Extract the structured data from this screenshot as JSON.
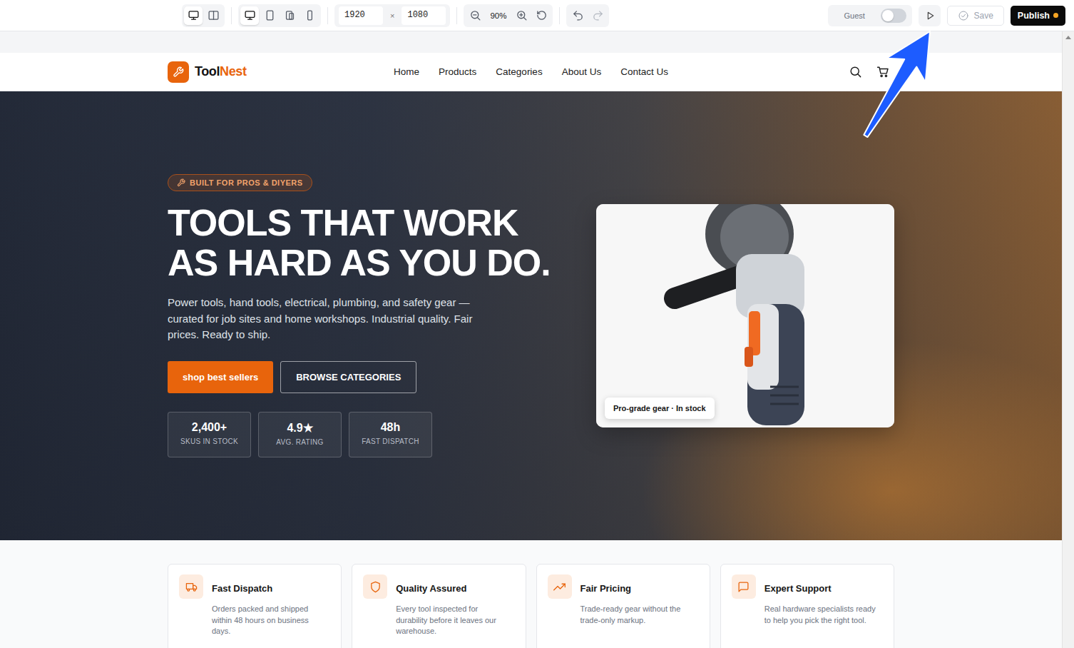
{
  "toolbar": {
    "view_modes": [
      {
        "kind": "single",
        "selected": true
      },
      {
        "kind": "split",
        "selected": false
      }
    ],
    "devices": [
      {
        "kind": "desktop",
        "selected": true
      },
      {
        "kind": "tablet",
        "selected": false
      },
      {
        "kind": "tablet-small",
        "selected": false
      },
      {
        "kind": "phone",
        "selected": false
      }
    ],
    "size": {
      "width": "1920",
      "separator": "×",
      "height": "1080"
    },
    "zoom": "90%",
    "history": {
      "undo_disabled": false,
      "redo_disabled": true
    },
    "preview_mode": {
      "label": "Guest",
      "on": false
    },
    "save": {
      "label": "Save",
      "disabled": true
    },
    "publish": {
      "label": "Publish",
      "unsaved": true
    }
  },
  "site": {
    "brand": {
      "first": "Tool",
      "second": "Nest"
    },
    "nav_links": [
      {
        "label": "Home",
        "selected": false
      },
      {
        "label": "Products",
        "selected": false
      },
      {
        "label": "Categories",
        "selected": false
      },
      {
        "label": "About Us",
        "selected": false
      },
      {
        "label": "Contact Us",
        "selected": false
      }
    ],
    "hero": {
      "badge": "BUILT FOR PROS & DIYERS",
      "headline": [
        "TOOLS THAT WORK",
        "AS HARD AS YOU DO."
      ],
      "text": "Power tools, hand tools, electrical, plumbing, and safety gear — curated for job sites and home workshops. Industrial quality. Fair prices. Ready to ship.",
      "primary_button": "shop best sellers",
      "secondary_button": "BROWSE CATEGORIES",
      "stats": [
        {
          "value": "2,400+",
          "label": "SKUS IN STOCK"
        },
        {
          "value": "4.9★",
          "label": "AVG. RATING"
        },
        {
          "value": "48h",
          "label": "FAST DISPATCH"
        }
      ],
      "image_caption": "Pro-grade gear · In stock"
    },
    "features": [
      {
        "kind": "truck",
        "title": "Fast Dispatch",
        "text": "Orders packed and shipped within 48 hours on business days."
      },
      {
        "kind": "shield",
        "title": "Quality Assured",
        "text": "Every tool inspected for durability before it leaves our warehouse."
      },
      {
        "kind": "trend",
        "title": "Fair Pricing",
        "text": "Trade-ready gear without the trade-only markup."
      },
      {
        "kind": "chat",
        "title": "Expert Support",
        "text": "Real hardware specialists ready to help you pick the right tool."
      }
    ]
  }
}
